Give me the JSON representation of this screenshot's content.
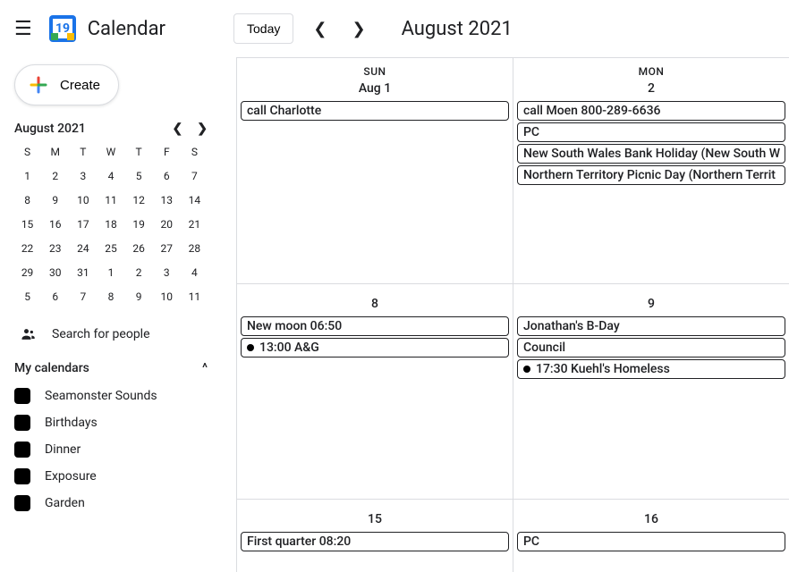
{
  "header": {
    "app_title": "Calendar",
    "today_label": "Today",
    "month_title": "August 2021",
    "logo_day": "19"
  },
  "sidebar": {
    "create_label": "Create",
    "mini_month": "August 2021",
    "mini_dow": [
      "S",
      "M",
      "T",
      "W",
      "T",
      "F",
      "S"
    ],
    "mini_days": [
      "1",
      "2",
      "3",
      "4",
      "5",
      "6",
      "7",
      "8",
      "9",
      "10",
      "11",
      "12",
      "13",
      "14",
      "15",
      "16",
      "17",
      "18",
      "19",
      "20",
      "21",
      "22",
      "23",
      "24",
      "25",
      "26",
      "27",
      "28",
      "29",
      "30",
      "31",
      "1",
      "2",
      "3",
      "4",
      "5",
      "6",
      "7",
      "8",
      "9",
      "10",
      "11"
    ],
    "search_people": "Search for people",
    "mycal_label": "My calendars",
    "calendars": [
      {
        "label": "Seamonster Sounds"
      },
      {
        "label": "Birthdays"
      },
      {
        "label": "Dinner"
      },
      {
        "label": "Exposure"
      },
      {
        "label": "Garden"
      }
    ]
  },
  "grid": {
    "weeks": [
      {
        "show_dow": true,
        "days": [
          {
            "dow": "SUN",
            "dom": "Aug 1",
            "events": [
              {
                "text": "call Charlotte",
                "dot": false
              }
            ]
          },
          {
            "dow": "MON",
            "dom": "2",
            "events": [
              {
                "text": "call Moen 800-289-6636",
                "dot": false
              },
              {
                "text": "PC",
                "dot": false
              },
              {
                "text": "New South Wales Bank Holiday (New South W",
                "dot": false
              },
              {
                "text": "Northern Territory Picnic Day (Northern Territ",
                "dot": false
              }
            ]
          }
        ]
      },
      {
        "show_dow": false,
        "days": [
          {
            "dom": "8",
            "events": [
              {
                "text": "New moon 06:50",
                "dot": false
              },
              {
                "text": "13:00 A&G",
                "dot": true
              }
            ]
          },
          {
            "dom": "9",
            "events": [
              {
                "text": "Jonathan's B-Day",
                "dot": false
              },
              {
                "text": "Council",
                "dot": false
              },
              {
                "text": "17:30 Kuehl's Homeless",
                "dot": true
              }
            ]
          }
        ]
      },
      {
        "show_dow": false,
        "days": [
          {
            "dom": "15",
            "events": [
              {
                "text": "First quarter 08:20",
                "dot": false
              }
            ]
          },
          {
            "dom": "16",
            "events": [
              {
                "text": "PC",
                "dot": false
              }
            ]
          }
        ]
      }
    ]
  }
}
